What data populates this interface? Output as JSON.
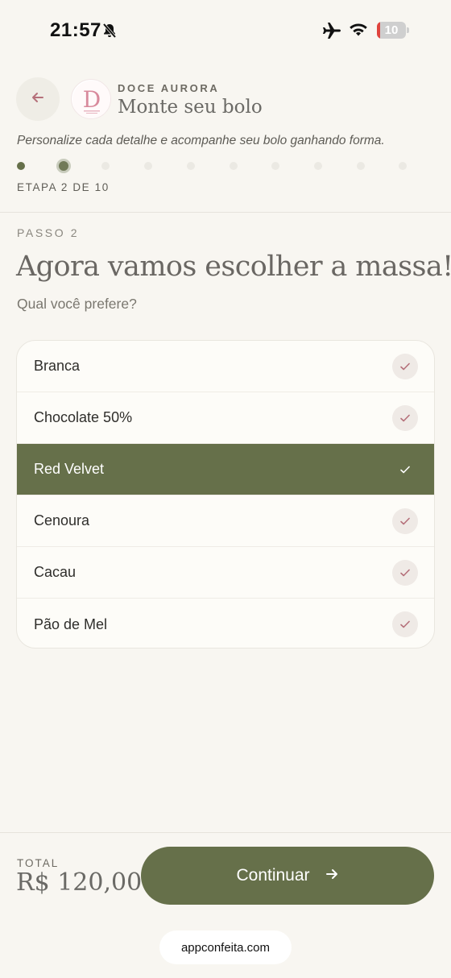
{
  "status_bar": {
    "time": "21:57",
    "battery": "10",
    "battery_level": 0.1
  },
  "header": {
    "brand": "DOCE AURORA",
    "logo_letter": "D",
    "title": "Monte seu bolo",
    "subtitle": "Personalize cada detalhe e acompanhe seu bolo ganhando forma.",
    "step_label": "ETAPA 2 DE 10",
    "current_step": 2,
    "total_steps": 10
  },
  "main": {
    "kicker": "PASSO 2",
    "title": "Agora vamos escolher a massa!",
    "subtitle": "Qual você prefere?",
    "options": [
      {
        "label": "Branca",
        "selected": false
      },
      {
        "label": "Chocolate 50%",
        "selected": false
      },
      {
        "label": "Red Velvet",
        "selected": true
      },
      {
        "label": "Cenoura",
        "selected": false
      },
      {
        "label": "Cacau",
        "selected": false
      },
      {
        "label": "Pão de Mel",
        "selected": false
      }
    ]
  },
  "footer": {
    "total_label": "TOTAL",
    "total_value": "R$ 120,00",
    "continue_label": "Continuar"
  },
  "browser": {
    "url": "appconfeita.com"
  },
  "colors": {
    "accent": "#66704a",
    "background": "#f8f6f1",
    "check_unselected": "#b5707a",
    "battery_low": "#e0433d"
  }
}
